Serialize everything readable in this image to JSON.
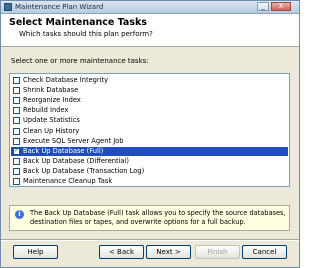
{
  "window": {
    "title": "Maintenance Plan Wizard",
    "controls": {
      "minimize": "_",
      "close": "X"
    }
  },
  "header": {
    "title": "Select Maintenance Tasks",
    "subtitle": "Which tasks should this plan perform?"
  },
  "task_list": {
    "label": "Select one or more maintenance tasks:",
    "items": [
      {
        "label": "Check Database Integrity",
        "checked": false,
        "selected": false
      },
      {
        "label": "Shrink Database",
        "checked": false,
        "selected": false
      },
      {
        "label": "Reorganize Index",
        "checked": false,
        "selected": false
      },
      {
        "label": "Rebuild Index",
        "checked": false,
        "selected": false
      },
      {
        "label": "Update Statistics",
        "checked": false,
        "selected": false
      },
      {
        "label": "Clean Up History",
        "checked": false,
        "selected": false
      },
      {
        "label": "Execute SQL Server Agent Job",
        "checked": false,
        "selected": false
      },
      {
        "label": "Back Up Database (Full)",
        "checked": true,
        "selected": true
      },
      {
        "label": "Back Up Database (Differential)",
        "checked": false,
        "selected": false
      },
      {
        "label": "Back Up Database (Transaction Log)",
        "checked": false,
        "selected": false
      },
      {
        "label": "Maintenance Cleanup Task",
        "checked": false,
        "selected": false
      }
    ]
  },
  "info": {
    "icon": "info-icon",
    "text": "The Back Up Database (Full) task allows you to specify the source databases, destination files or tapes, and overwrite options for a full backup."
  },
  "buttons": {
    "help": "Help",
    "back": "< Back",
    "next": "Next >",
    "finish": "Finish",
    "cancel": "Cancel"
  }
}
